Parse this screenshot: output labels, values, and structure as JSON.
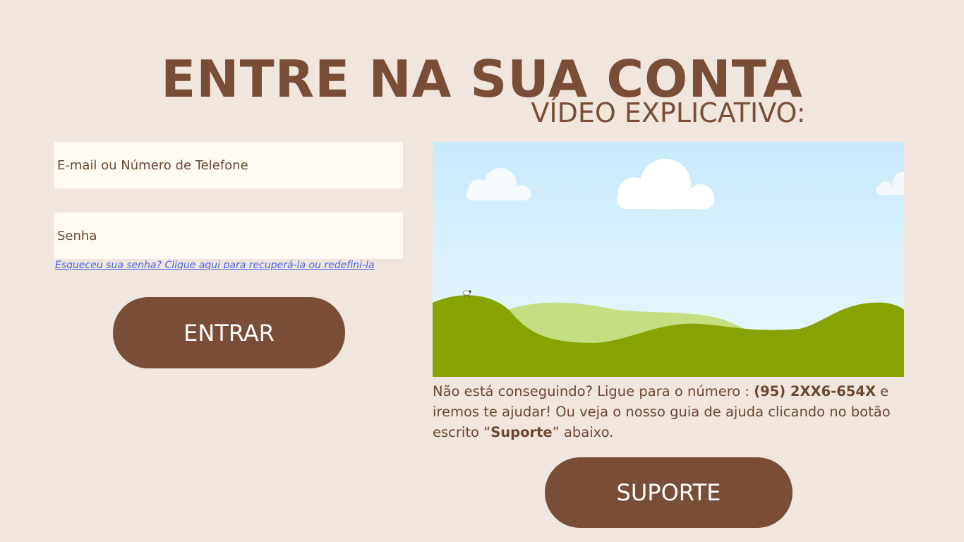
{
  "header": {
    "title": "ENTRE NA SUA CONTA"
  },
  "login": {
    "email_placeholder": "E-mail ou Número de Telefone",
    "password_placeholder": "Senha",
    "forgot_link": "Esqueceu sua senha? Clique aqui para recuperá-la ou redefini-la",
    "submit_label": "ENTRAR"
  },
  "video": {
    "heading": "VÍDEO EXPLICATIVO:"
  },
  "help": {
    "text_part1": "Não está conseguindo? Ligue para o número : ",
    "phone": "(95) 2XX6-654X",
    "text_part2": " e iremos te ajudar! Ou veja o nosso guia de ajuda clicando no botão escrito “",
    "support_word": "Suporte",
    "text_part3": "” abaixo."
  },
  "support": {
    "button_label": "SUPORTE"
  },
  "colors": {
    "background": "#F0E6DE",
    "brand_brown": "#7A4D36",
    "input_bg": "#FFFBF2",
    "link_blue": "#4A64E6",
    "sky_top": "#C8E9FB",
    "sky_bottom": "#EEF9FF",
    "hill_dark": "#86A300",
    "hill_light": "#C5DE82"
  }
}
